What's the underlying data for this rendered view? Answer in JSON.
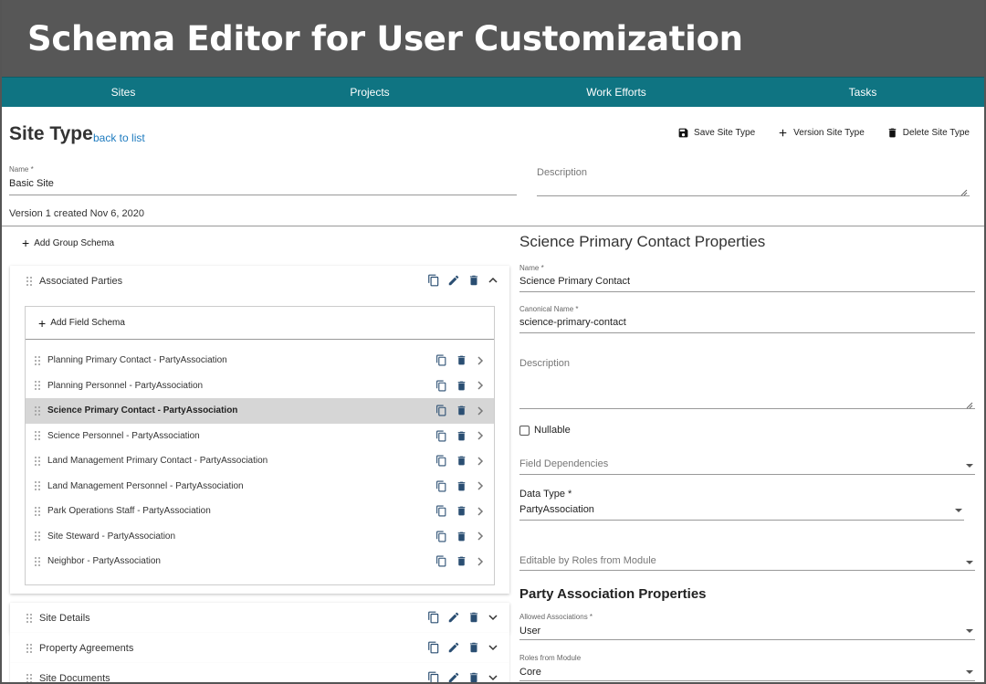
{
  "hero": {
    "title": "Schema Editor for User Customization"
  },
  "nav": {
    "items": [
      "Sites",
      "Projects",
      "Work Efforts",
      "Tasks"
    ]
  },
  "page": {
    "title": "Site Type",
    "back_link": "back to list",
    "actions": {
      "save": "Save Site Type",
      "version": "Version Site Type",
      "delete": "Delete Site Type"
    }
  },
  "form": {
    "name_label": "Name *",
    "name_value": "Basic Site",
    "description_placeholder": "Description",
    "version_text": "Version 1 created Nov 6, 2020"
  },
  "groups": {
    "add_group_label": "Add Group Schema",
    "add_field_label": "Add Field Schema",
    "expanded": {
      "label": "Associated Parties",
      "fields": [
        "Planning Primary Contact - PartyAssociation",
        "Planning Personnel - PartyAssociation",
        "Science Primary Contact - PartyAssociation",
        "Science Personnel - PartyAssociation",
        "Land Management Primary Contact - PartyAssociation",
        "Land Management Personnel - PartyAssociation",
        "Park Operations Staff - PartyAssociation",
        "Site Steward - PartyAssociation",
        "Neighbor - PartyAssociation"
      ],
      "selected_index": 2
    },
    "collapsed": [
      "Site Details",
      "Property Agreements",
      "Site Documents"
    ]
  },
  "properties": {
    "heading": "Science Primary Contact Properties",
    "name_label": "Name *",
    "name_value": "Science Primary Contact",
    "canonical_label": "Canonical Name *",
    "canonical_value": "science-primary-contact",
    "description_placeholder": "Description",
    "nullable_label": "Nullable",
    "dependencies_placeholder": "Field Dependencies",
    "data_type_label": "Data Type *",
    "data_type_value": "PartyAssociation",
    "editable_placeholder": "Editable by Roles from Module",
    "party_heading": "Party Association Properties",
    "allowed_label": "Allowed Associations *",
    "allowed_value": "User",
    "roles_label": "Roles from Module",
    "roles_value": "Core"
  }
}
